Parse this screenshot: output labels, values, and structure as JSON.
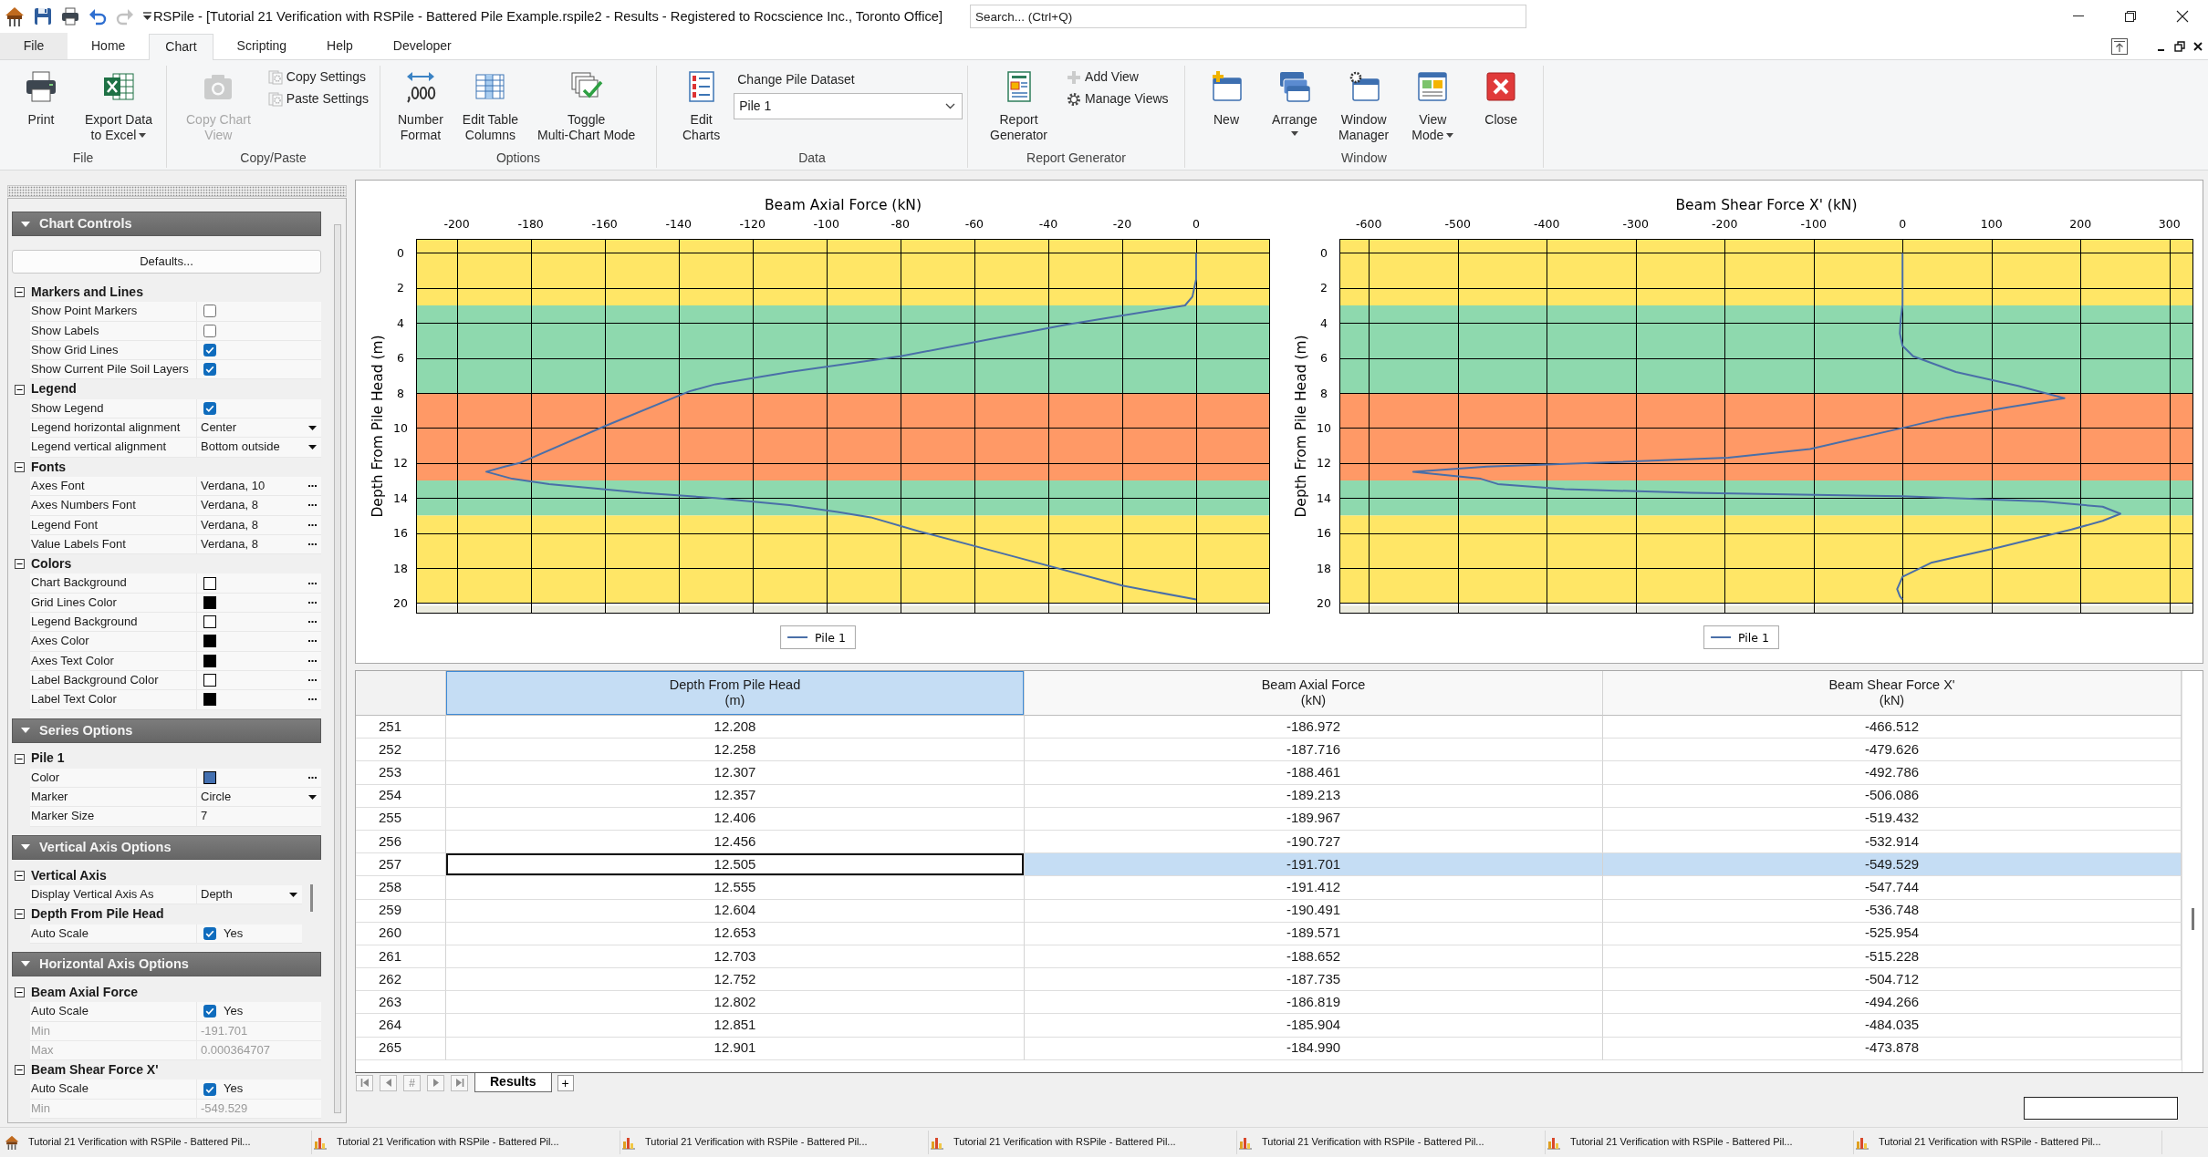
{
  "title_bar": {
    "quick_access": [
      {
        "disabled": false
      },
      {
        "disabled": false
      },
      {
        "disabled": false
      },
      {
        "disabled": true
      }
    ],
    "title": "RSPile - [Tutorial 21 Verification with RSPile - Battered Pile Example.rspile2 - Results - Registered to Rocscience Inc., Toronto Office]",
    "search": {
      "placeholder": "Search... (Ctrl+Q)"
    }
  },
  "ribbon": {
    "tabs": [
      {
        "label": "File",
        "kind": "backstage",
        "selected": false
      },
      {
        "label": "Home",
        "kind": "tab",
        "selected": false
      },
      {
        "label": "Chart",
        "kind": "tab",
        "selected": true
      },
      {
        "label": "Scripting",
        "kind": "tab",
        "selected": false
      },
      {
        "label": "Help",
        "kind": "tab",
        "selected": false
      },
      {
        "label": "Developer",
        "kind": "tab",
        "selected": false
      }
    ],
    "groups": [
      {
        "label": "File",
        "items": [
          {
            "kind": "large",
            "label": "Print",
            "disabled": false
          },
          {
            "kind": "menu",
            "label": "Export Data\nto Excel",
            "disabled": false
          }
        ]
      },
      {
        "label": "Copy/Paste",
        "items": [
          {
            "kind": "large",
            "label": "Copy Chart\nView",
            "disabled": true
          },
          {
            "kind": "small",
            "label": "Copy Settings",
            "disabled": true
          },
          {
            "kind": "small",
            "label": "Paste Settings",
            "disabled": true
          }
        ]
      },
      {
        "label": "Options",
        "items": [
          {
            "kind": "large",
            "label": "Number\nFormat",
            "disabled": false
          },
          {
            "kind": "large",
            "label": "Edit Table\nColumns",
            "disabled": false
          },
          {
            "kind": "large",
            "label": "Toggle\nMulti-Chart Mode",
            "disabled": false
          }
        ]
      },
      {
        "label": "Data",
        "items": [
          {
            "kind": "large",
            "label": "Edit\nCharts",
            "disabled": false
          },
          {
            "kind": "combo",
            "label": "Change Pile Dataset",
            "value": "Pile 1"
          }
        ]
      },
      {
        "label": "Report Generator",
        "items": [
          {
            "kind": "large",
            "label": "Report\nGenerator",
            "disabled": false
          },
          {
            "kind": "small",
            "label": "Add View",
            "disabled": true
          },
          {
            "kind": "small",
            "label": "Manage Views",
            "disabled": false
          }
        ]
      },
      {
        "label": "Window",
        "items": [
          {
            "kind": "large",
            "label": "New",
            "disabled": false
          },
          {
            "kind": "split",
            "label": "Arrange",
            "disabled": false
          },
          {
            "kind": "large",
            "label": "Window\nManager",
            "disabled": false
          },
          {
            "kind": "menu",
            "label": "View\nMode",
            "disabled": false
          },
          {
            "kind": "large",
            "label": "Close",
            "disabled": false
          }
        ]
      }
    ]
  },
  "chart_controls": {
    "sections": [
      {
        "title": "Chart Controls",
        "expanded": true,
        "scrollbar": false,
        "button": "Defaults...",
        "groups": [
          {
            "title": "Markers and Lines",
            "expanded": true,
            "rows": [
              {
                "kind": "checkbox",
                "name": "Show Point Markers",
                "checked": false
              },
              {
                "kind": "checkbox",
                "name": "Show Labels",
                "checked": false
              },
              {
                "kind": "checkbox",
                "name": "Show Grid Lines",
                "checked": true
              },
              {
                "kind": "checkbox",
                "name": "Show Current Pile Soil Layers",
                "checked": true
              }
            ]
          },
          {
            "title": "Legend",
            "expanded": true,
            "rows": [
              {
                "kind": "checkbox",
                "name": "Show Legend",
                "checked": true
              },
              {
                "kind": "dropdown",
                "name": "Legend horizontal alignment",
                "value": "Center"
              },
              {
                "kind": "dropdown",
                "name": "Legend vertical alignment",
                "value": "Bottom outside"
              }
            ]
          },
          {
            "title": "Fonts",
            "expanded": true,
            "rows": [
              {
                "kind": "font",
                "name": "Axes Font",
                "value": "Verdana, 10"
              },
              {
                "kind": "font",
                "name": "Axes Numbers Font",
                "value": "Verdana, 8"
              },
              {
                "kind": "font",
                "name": "Legend Font",
                "value": "Verdana, 8"
              },
              {
                "kind": "font",
                "name": "Value Labels Font",
                "value": "Verdana, 8"
              }
            ]
          },
          {
            "title": "Colors",
            "expanded": true,
            "rows": [
              {
                "kind": "color",
                "name": "Chart Background",
                "color": "#ffffff"
              },
              {
                "kind": "color",
                "name": "Grid Lines Color",
                "color": "#000000"
              },
              {
                "kind": "color",
                "name": "Legend Background",
                "color": "#ffffff"
              },
              {
                "kind": "color",
                "name": "Axes Color",
                "color": "#000000"
              },
              {
                "kind": "color",
                "name": "Axes Text Color",
                "color": "#000000"
              },
              {
                "kind": "color",
                "name": "Label Background Color",
                "color": "#ffffff"
              },
              {
                "kind": "color",
                "name": "Label Text Color",
                "color": "#000000"
              }
            ]
          }
        ]
      },
      {
        "title": "Series Options",
        "expanded": true,
        "scrollbar": false,
        "groups": [
          {
            "title": "Pile 1",
            "expanded": true,
            "rows": [
              {
                "kind": "color",
                "name": "Color",
                "color": "#4470b0"
              },
              {
                "kind": "dropdown",
                "name": "Marker",
                "value": "Circle"
              },
              {
                "kind": "text",
                "name": "Marker Size",
                "value": "7"
              }
            ]
          }
        ]
      },
      {
        "title": "Vertical Axis Options",
        "expanded": true,
        "scrollbar": true,
        "groups": [
          {
            "title": "Vertical Axis",
            "expanded": true,
            "rows": [
              {
                "kind": "dropdown",
                "name": "Display Vertical Axis As",
                "value": "Depth"
              }
            ]
          },
          {
            "title": "Depth From Pile Head",
            "expanded": true,
            "rows": [
              {
                "kind": "toggle",
                "name": "Auto Scale",
                "checked": true,
                "value": "Yes"
              }
            ]
          }
        ]
      },
      {
        "title": "Horizontal Axis Options",
        "expanded": true,
        "scrollbar": false,
        "groups": [
          {
            "title": "Beam Axial Force",
            "expanded": true,
            "rows": [
              {
                "kind": "toggle",
                "name": "Auto Scale",
                "checked": true,
                "value": "Yes"
              },
              {
                "kind": "readonly",
                "name": "Min",
                "value": "-191.701"
              },
              {
                "kind": "readonly",
                "name": "Max",
                "value": "0.000364707"
              }
            ]
          },
          {
            "title": "Beam Shear Force X'",
            "expanded": true,
            "rows": [
              {
                "kind": "toggle",
                "name": "Auto Scale",
                "checked": true,
                "value": "Yes"
              },
              {
                "kind": "readonly",
                "name": "Min",
                "value": "-549.529"
              }
            ]
          }
        ]
      }
    ]
  },
  "charts": [
    {
      "chart_data": {
        "type": "line",
        "xlabel": "Beam Axial Force (kN)",
        "ylabel": "Depth From Pile Head (m)",
        "x": [
          0,
          0,
          -1,
          -3,
          -35,
          -80,
          -110,
          -130,
          -137,
          -160,
          -183,
          -187,
          -192,
          -185,
          -175,
          -150,
          -130,
          -110,
          -97,
          -88,
          -75,
          -50,
          -20,
          0
        ],
        "series": [
          {
            "name": "Pile 1",
            "color": "#4a6fa8",
            "values": [
              0,
              1.5,
              2.5,
              3.0,
              4.1,
              5.9,
              6.8,
              7.5,
              7.9,
              9.9,
              12.0,
              12.2,
              12.5,
              12.9,
              13.2,
              13.7,
              14.0,
              14.4,
              14.8,
              15.1,
              15.9,
              17.3,
              19.0,
              19.8
            ]
          }
        ],
        "xlim": [
          -211,
          20
        ],
        "ylim": [
          20.6,
          -0.8
        ],
        "xticks": [
          -200,
          -180,
          -160,
          -140,
          -120,
          -100,
          -80,
          -60,
          -40,
          -20,
          0
        ],
        "yticks": [
          0,
          2,
          4,
          6,
          8,
          10,
          12,
          14,
          16,
          18,
          20
        ],
        "grid": true,
        "bands": [
          {
            "axis": "y",
            "from": -0.8,
            "to": 3,
            "color": "#ffe666"
          },
          {
            "axis": "y",
            "from": 3,
            "to": 8,
            "color": "#8ed9ae"
          },
          {
            "axis": "y",
            "from": 8,
            "to": 13,
            "color": "#ff9966"
          },
          {
            "axis": "y",
            "from": 13,
            "to": 15,
            "color": "#8ed9ae"
          },
          {
            "axis": "y",
            "from": 15,
            "to": 20,
            "color": "#ffe666"
          },
          {
            "axis": "y",
            "from": 20.15,
            "to": 20.6,
            "color": "#ebebdf"
          }
        ]
      }
    },
    {
      "chart_data": {
        "type": "line",
        "xlabel": "Beam Shear Force X' (kN)",
        "ylabel": "Depth From Pile Head (m)",
        "x": [
          0,
          0,
          -2,
          -3,
          0,
          12,
          60,
          130,
          182,
          120,
          50,
          0,
          -104,
          -196,
          -406,
          -467,
          -550,
          -474,
          -455,
          -380,
          -237,
          0,
          158,
          225,
          245,
          225,
          190,
          110,
          32,
          0,
          -6,
          -3,
          0
        ],
        "series": [
          {
            "name": "Pile 1",
            "color": "#4a6fa8",
            "values": [
              0,
              3,
              3.8,
              4.6,
              5.3,
              5.9,
              6.8,
              7.6,
              8.3,
              8.8,
              9.4,
              10.0,
              11.2,
              11.7,
              12.1,
              12.2,
              12.5,
              12.9,
              13.2,
              13.5,
              13.7,
              13.9,
              14.2,
              14.5,
              14.9,
              15.3,
              15.8,
              16.8,
              17.7,
              18.5,
              19.2,
              19.6,
              19.8
            ]
          }
        ],
        "xlim": [
          -633,
          327
        ],
        "ylim": [
          20.6,
          -0.8
        ],
        "xticks": [
          -600,
          -500,
          -400,
          -300,
          -200,
          -100,
          0,
          100,
          200,
          300
        ],
        "yticks": [
          0,
          2,
          4,
          6,
          8,
          10,
          12,
          14,
          16,
          18,
          20
        ],
        "grid": true,
        "bands": [
          {
            "axis": "y",
            "from": -0.8,
            "to": 3,
            "color": "#ffe666"
          },
          {
            "axis": "y",
            "from": 3,
            "to": 8,
            "color": "#8ed9ae"
          },
          {
            "axis": "y",
            "from": 8,
            "to": 13,
            "color": "#ff9966"
          },
          {
            "axis": "y",
            "from": 13,
            "to": 15,
            "color": "#8ed9ae"
          },
          {
            "axis": "y",
            "from": 15,
            "to": 20,
            "color": "#ffe666"
          },
          {
            "axis": "y",
            "from": 20.15,
            "to": 20.6,
            "color": "#ebebdf"
          }
        ]
      }
    }
  ],
  "table": {
    "columns": [
      {
        "title": "Depth From Pile Head\n(m)",
        "selected": true
      },
      {
        "title": "Beam Axial Force\n(kN)",
        "selected": false
      },
      {
        "title": "Beam Shear Force X'\n(kN)",
        "selected": false
      }
    ],
    "rows": [
      {
        "number": "251",
        "cells": [
          "12.208",
          "-186.972",
          "-466.512"
        ],
        "selected": false
      },
      {
        "number": "252",
        "cells": [
          "12.258",
          "-187.716",
          "-479.626"
        ],
        "selected": false
      },
      {
        "number": "253",
        "cells": [
          "12.307",
          "-188.461",
          "-492.786"
        ],
        "selected": false
      },
      {
        "number": "254",
        "cells": [
          "12.357",
          "-189.213",
          "-506.086"
        ],
        "selected": false
      },
      {
        "number": "255",
        "cells": [
          "12.406",
          "-189.967",
          "-519.432"
        ],
        "selected": false
      },
      {
        "number": "256",
        "cells": [
          "12.456",
          "-190.727",
          "-532.914"
        ],
        "selected": false
      },
      {
        "number": "257",
        "cells": [
          "12.505",
          "-191.701",
          "-549.529"
        ],
        "selected": true
      },
      {
        "number": "258",
        "cells": [
          "12.555",
          "-191.412",
          "-547.744"
        ],
        "selected": false
      },
      {
        "number": "259",
        "cells": [
          "12.604",
          "-190.491",
          "-536.748"
        ],
        "selected": false
      },
      {
        "number": "260",
        "cells": [
          "12.653",
          "-189.571",
          "-525.954"
        ],
        "selected": false
      },
      {
        "number": "261",
        "cells": [
          "12.703",
          "-188.652",
          "-515.228"
        ],
        "selected": false
      },
      {
        "number": "262",
        "cells": [
          "12.752",
          "-187.735",
          "-504.712"
        ],
        "selected": false
      },
      {
        "number": "263",
        "cells": [
          "12.802",
          "-186.819",
          "-494.266"
        ],
        "selected": false
      },
      {
        "number": "264",
        "cells": [
          "12.851",
          "-185.904",
          "-484.035"
        ],
        "selected": false
      },
      {
        "number": "265",
        "cells": [
          "12.901",
          "-184.990",
          "-473.878"
        ],
        "selected": false
      }
    ]
  },
  "sheet_bar": {
    "goto": "#",
    "tabs": [
      {
        "label": "Results",
        "selected": true
      }
    ],
    "add": "+"
  },
  "taskbar": {
    "items": [
      {
        "kind": "model",
        "label": "Tutorial 21 Verification with RSPile - Battered Pil..."
      },
      {
        "kind": "chart",
        "label": "Tutorial 21 Verification with RSPile - Battered Pil..."
      },
      {
        "kind": "chart",
        "label": "Tutorial 21 Verification with RSPile - Battered Pil..."
      },
      {
        "kind": "chart",
        "label": "Tutorial 21 Verification with RSPile - Battered Pil..."
      },
      {
        "kind": "chart",
        "label": "Tutorial 21 Verification with RSPile - Battered Pil..."
      },
      {
        "kind": "chart",
        "label": "Tutorial 21 Verification with RSPile - Battered Pil..."
      },
      {
        "kind": "chart",
        "label": "Tutorial 21 Verification with RSPile - Battered Pil..."
      }
    ]
  }
}
